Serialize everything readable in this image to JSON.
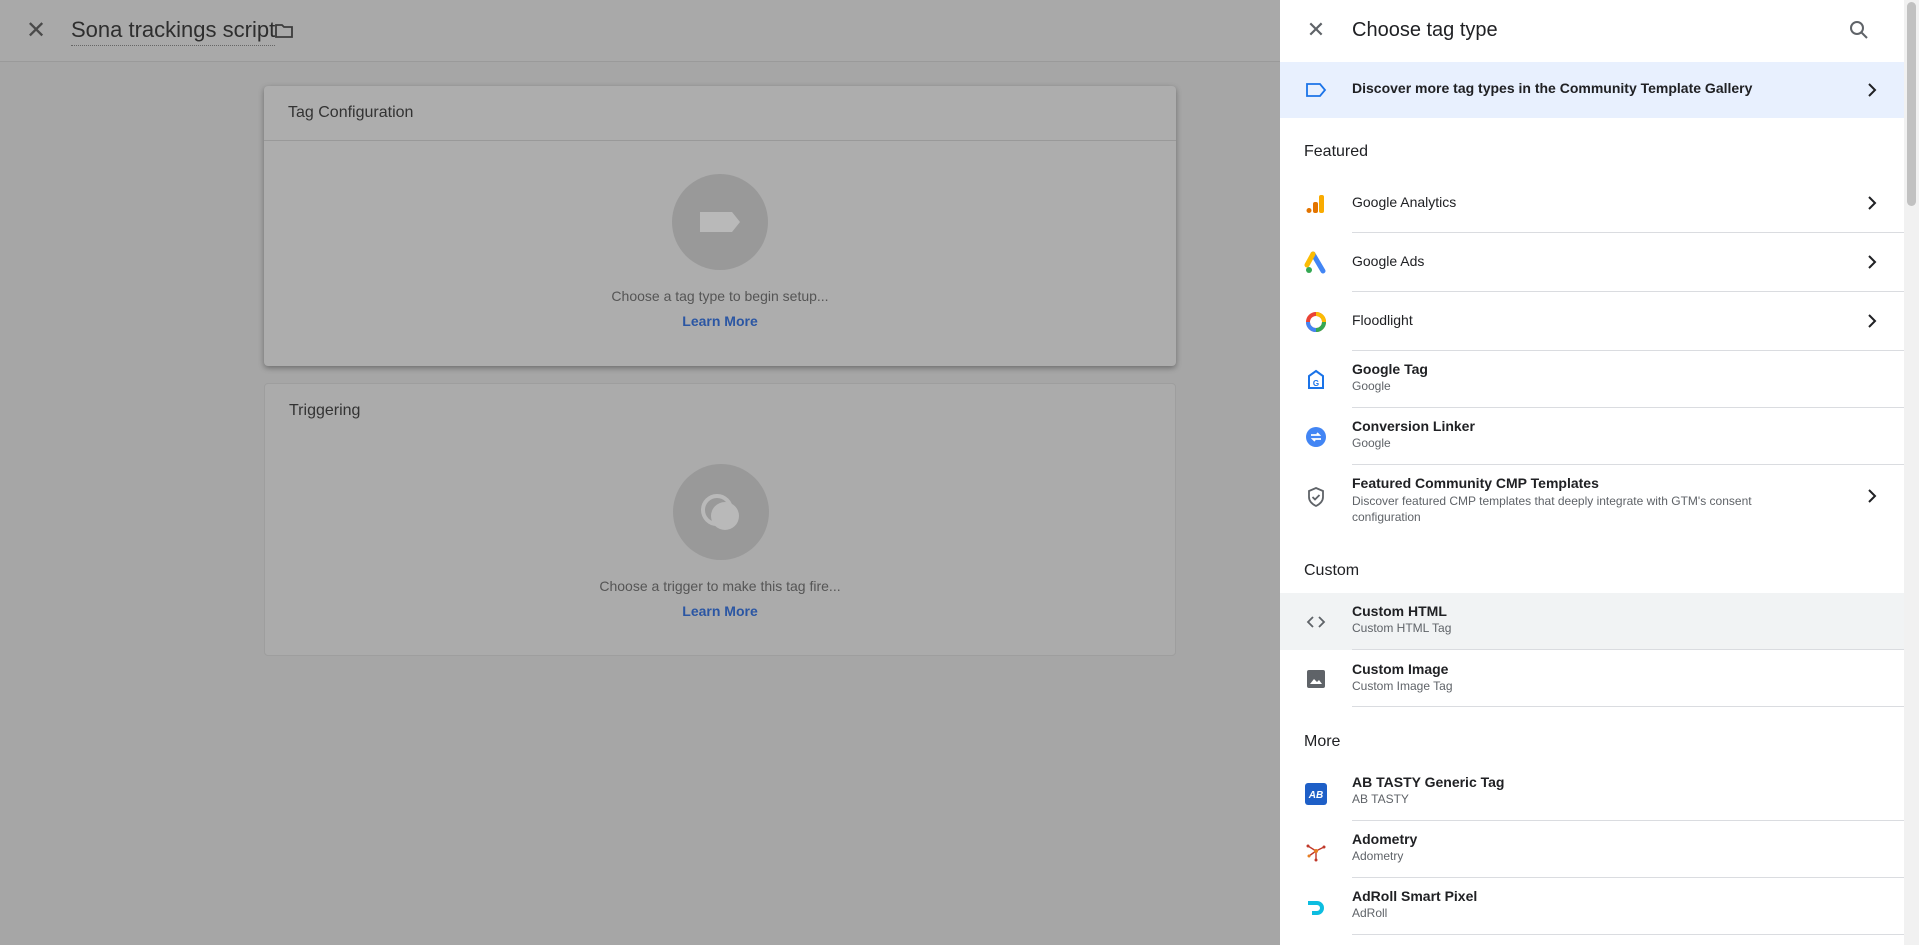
{
  "editor": {
    "title": "Sona trackings script",
    "tag_config": {
      "title": "Tag Configuration",
      "hint": "Choose a tag type to begin setup...",
      "learn_more": "Learn More"
    },
    "triggering": {
      "title": "Triggering",
      "hint": "Choose a trigger to make this tag fire...",
      "learn_more": "Learn More"
    }
  },
  "panel": {
    "title": "Choose tag type",
    "discover_label": "Discover more tag types in the Community Template Gallery",
    "sections": {
      "featured": "Featured",
      "custom": "Custom",
      "more": "More"
    },
    "featured": [
      {
        "name": "Google Analytics",
        "icon": "google-analytics-icon"
      },
      {
        "name": "Google Ads",
        "icon": "google-ads-icon"
      },
      {
        "name": "Floodlight",
        "icon": "floodlight-icon"
      },
      {
        "name": "Google Tag",
        "sub": "Google",
        "icon": "google-tag-icon"
      },
      {
        "name": "Conversion Linker",
        "sub": "Google",
        "icon": "conversion-linker-icon"
      },
      {
        "name": "Featured Community CMP Templates",
        "desc": "Discover featured CMP templates that deeply integrate with GTM's consent configuration",
        "icon": "shield-check-icon"
      }
    ],
    "custom": [
      {
        "name": "Custom HTML",
        "sub": "Custom HTML Tag",
        "icon": "code-icon"
      },
      {
        "name": "Custom Image",
        "sub": "Custom Image Tag",
        "icon": "image-icon"
      }
    ],
    "more": [
      {
        "name": "AB TASTY Generic Tag",
        "sub": "AB TASTY",
        "icon": "ab-tasty-icon"
      },
      {
        "name": "Adometry",
        "sub": "Adometry",
        "icon": "adometry-icon"
      },
      {
        "name": "AdRoll Smart Pixel",
        "sub": "AdRoll",
        "icon": "adroll-icon"
      }
    ]
  },
  "colors": {
    "accent": "#1a73e8",
    "highlight_bg": "#e8f0fe",
    "overlay": "#a6a6a6"
  }
}
